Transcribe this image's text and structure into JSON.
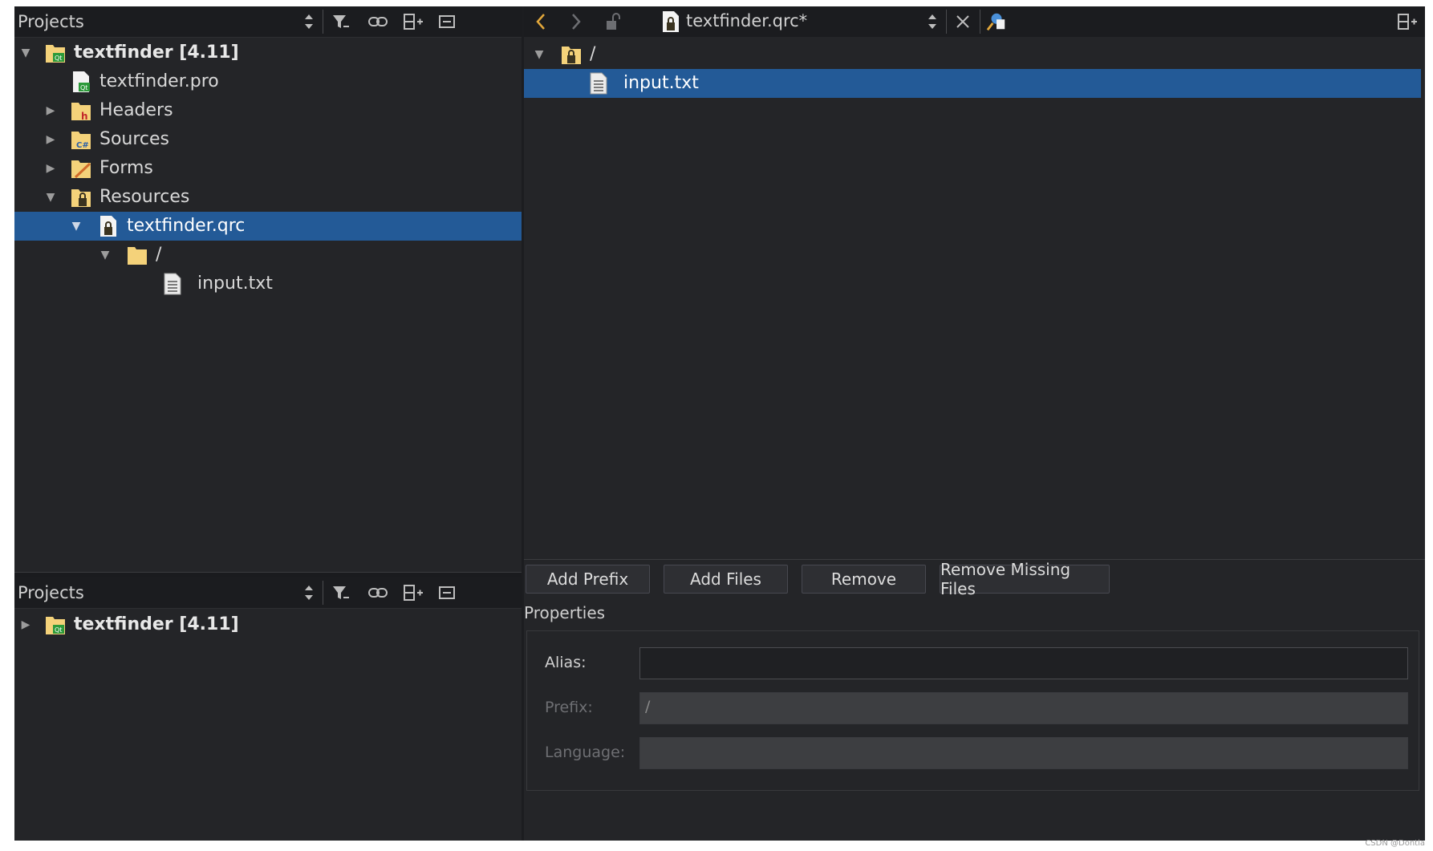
{
  "projects_panel_top": {
    "title": "Projects",
    "header_icons": [
      "sort-updown-icon",
      "filter-icon",
      "link-icon",
      "split-add-icon",
      "close-panel-icon"
    ],
    "tree": [
      {
        "label": "textfinder [4.11]",
        "bold": true,
        "expanded": true,
        "icon": "qt-project-icon"
      },
      {
        "label": "textfinder.pro",
        "icon": "pro-file-icon"
      },
      {
        "label": "Headers",
        "collapsed": true,
        "icon": "headers-folder-icon"
      },
      {
        "label": "Sources",
        "collapsed": true,
        "icon": "sources-folder-icon"
      },
      {
        "label": "Forms",
        "collapsed": true,
        "icon": "forms-folder-icon"
      },
      {
        "label": "Resources",
        "expanded": true,
        "icon": "resources-folder-icon"
      },
      {
        "label": "textfinder.qrc",
        "expanded": true,
        "selected": true,
        "icon": "qrc-file-icon"
      },
      {
        "label": "/",
        "expanded": true,
        "icon": "folder-icon"
      },
      {
        "label": "input.txt",
        "icon": "text-file-icon"
      }
    ]
  },
  "projects_panel_bottom": {
    "title": "Projects",
    "tree": [
      {
        "label": "textfinder [4.11]",
        "bold": true,
        "collapsed": true,
        "icon": "qt-project-icon"
      }
    ]
  },
  "editor": {
    "file_title": "textfinder.qrc*",
    "resource_tree": [
      {
        "label": "/",
        "expanded": true,
        "icon": "qrc-prefix-icon"
      },
      {
        "label": "input.txt",
        "selected": true,
        "icon": "text-file-icon"
      }
    ],
    "buttons": {
      "add_prefix": "Add Prefix",
      "add_files": "Add Files",
      "remove": "Remove",
      "remove_missing": "Remove Missing Files"
    },
    "properties": {
      "title": "Properties",
      "alias_label": "Alias:",
      "alias_value": "",
      "prefix_label": "Prefix:",
      "prefix_value": "/",
      "language_label": "Language:",
      "language_value": ""
    }
  },
  "colors": {
    "selection": "#235a97",
    "background": "#242528",
    "header": "#1b1c1f"
  },
  "watermark": "CSDN @Dontla"
}
